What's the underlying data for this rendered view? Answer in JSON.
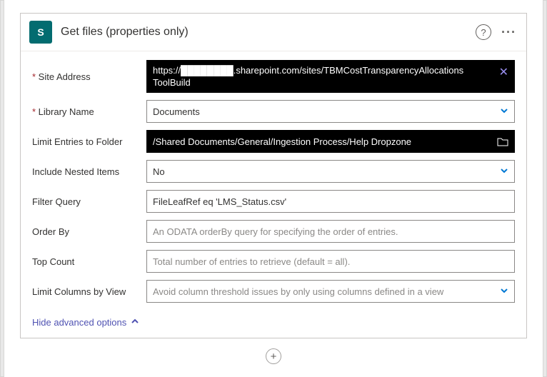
{
  "header": {
    "icon_letter": "S",
    "title": "Get files (properties only)",
    "help_glyph": "?",
    "menu_glyph": "···"
  },
  "fields": {
    "siteAddress": {
      "label": "Site Address",
      "value": "https://████████.sharepoint.com/sites/TBMCostTransparencyAllocations\nToolBuild"
    },
    "libraryName": {
      "label": "Library Name",
      "value": "Documents"
    },
    "limitFolder": {
      "label": "Limit Entries to Folder",
      "value": "/Shared Documents/General/Ingestion Process/Help Dropzone"
    },
    "includeNested": {
      "label": "Include Nested Items",
      "value": "No"
    },
    "filterQuery": {
      "label": "Filter Query",
      "value": "FileLeafRef eq 'LMS_Status.csv'"
    },
    "orderBy": {
      "label": "Order By",
      "placeholder": "An ODATA orderBy query for specifying the order of entries."
    },
    "topCount": {
      "label": "Top Count",
      "placeholder": "Total number of entries to retrieve (default = all)."
    },
    "limitColumns": {
      "label": "Limit Columns by View",
      "placeholder": "Avoid column threshold issues by only using columns defined in a view"
    }
  },
  "advanced": {
    "label": "Hide advanced options"
  },
  "addStep": {
    "glyph": "+"
  }
}
